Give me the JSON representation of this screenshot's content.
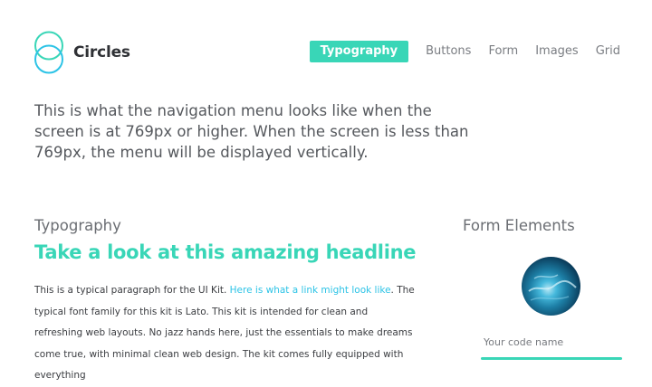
{
  "brand": {
    "name": "Circles"
  },
  "nav": {
    "items": [
      "Typography",
      "Buttons",
      "Form",
      "Images",
      "Grid"
    ],
    "active": "Typography"
  },
  "intro": "This is what the navigation menu looks like when the screen is at 769px or higher. When the screen is less than 769px, the menu will be displayed vertically.",
  "typography": {
    "title": "Typography",
    "headline": "Take a look at this amazing headline",
    "paragraph_start": "This is a typical paragraph for the UI Kit. ",
    "link_text": "Here is what a link might look like",
    "paragraph_end": ". The typical font family for this kit is Lato. This kit is intended for clean and refreshing web layouts. No jazz hands here, just the essentials to make dreams come true, with minimal clean web design. The kit comes fully equipped with everything"
  },
  "form": {
    "title": "Form Elements",
    "code_name_placeholder": "Your code name"
  },
  "colors": {
    "accent": "#39d6b7",
    "link": "#2cc3e6"
  }
}
